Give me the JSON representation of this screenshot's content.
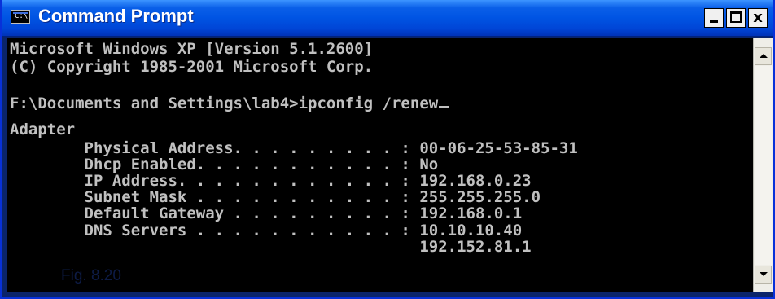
{
  "window": {
    "title": "Command Prompt",
    "icon_label": "C:\\",
    "icon": "console-icon",
    "controls": {
      "minimize": "minimize-icon",
      "maximize": "maximize-icon",
      "close": "close-icon",
      "close_glyph": "x"
    }
  },
  "console": {
    "lines": [
      "Microsoft Windows XP [Version 5.1.2600]",
      "(C) Copyright 1985-2001 Microsoft Corp.",
      "",
      "F:\\Documents and Settings\\lab4>ipconfig /renew",
      "",
      "Adapter",
      "        Physical Address. . . . . . . . . : 00-06-25-53-85-31",
      "        Dhcp Enabled. . . . . . . . . . . : No",
      "        IP Address. . . . . . . . . . . . : 192.168.0.23",
      "        Subnet Mask . . . . . . . . . . . : 255.255.255.0",
      "        Default Gateway . . . . . . . . . : 192.168.0.1",
      "        DNS Servers . . . . . . . . . . . : 10.10.10.40",
      "                                            192.152.81.1"
    ]
  },
  "caption": "Fig. 8.20",
  "colors": {
    "console_bg": "#000000",
    "console_text": "#C0C0C0",
    "titlebar": "#0054E3"
  }
}
